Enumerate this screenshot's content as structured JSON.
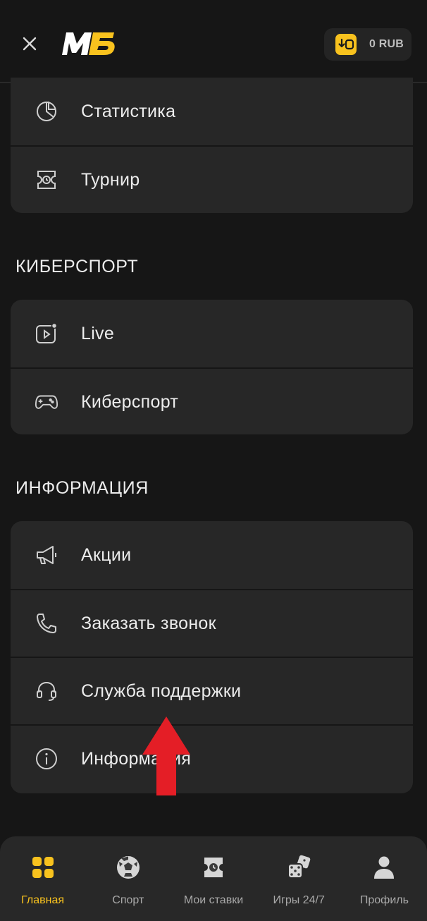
{
  "header": {
    "logo_text": "МБ",
    "balance": "0 RUB",
    "close_icon": "close-icon",
    "wallet_icon": "wallet-icon"
  },
  "top_card": {
    "items": [
      {
        "label": "Статистика",
        "icon": "pie-chart-icon"
      },
      {
        "label": "Турнир",
        "icon": "tournament-ticket-icon"
      }
    ]
  },
  "esports": {
    "title": "КИБЕРСПОРТ",
    "items": [
      {
        "label": "Live",
        "icon": "live-video-icon"
      },
      {
        "label": "Киберспорт",
        "icon": "gamepad-icon"
      }
    ]
  },
  "info": {
    "title": "ИНФОРМАЦИЯ",
    "items": [
      {
        "label": "Акции",
        "icon": "megaphone-icon"
      },
      {
        "label": "Заказать звонок",
        "icon": "phone-icon"
      },
      {
        "label": "Служба поддержки",
        "icon": "headset-icon"
      },
      {
        "label": "Информация",
        "icon": "info-icon"
      }
    ]
  },
  "bottom_nav": {
    "items": [
      {
        "label": "Главная",
        "icon": "home-grid-icon",
        "active": true
      },
      {
        "label": "Спорт",
        "icon": "soccer-ball-icon"
      },
      {
        "label": "Мои ставки",
        "icon": "bet-ticket-icon"
      },
      {
        "label": "Игры 24/7",
        "icon": "dice-icon"
      },
      {
        "label": "Профиль",
        "icon": "user-icon"
      }
    ]
  },
  "colors": {
    "background": "#161616",
    "card": "#272727",
    "accent": "#f8c21e",
    "annotation_arrow": "#e41e26"
  }
}
